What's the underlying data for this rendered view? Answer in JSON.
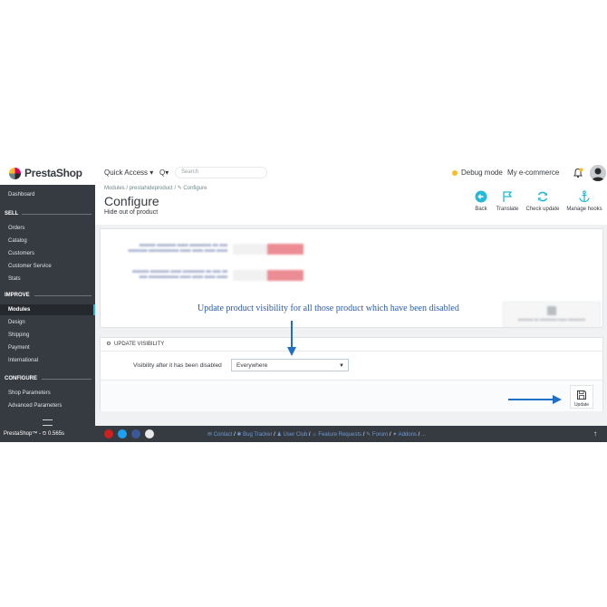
{
  "topbar": {
    "logo_text": "PrestaShop",
    "quick_access": "Quick Access ▾",
    "search_button": "Q▾",
    "search_placeholder": "Search",
    "debug_mode": "Debug mode",
    "shop_name": "My e-commerce"
  },
  "sidebar": {
    "dashboard": "Dashboard",
    "sections": [
      {
        "title": "SELL",
        "items": [
          "Orders",
          "Catalog",
          "Customers",
          "Customer Service",
          "Stats"
        ]
      },
      {
        "title": "IMPROVE",
        "items": [
          "Modules",
          "Design",
          "Shipping",
          "Payment",
          "International"
        ]
      },
      {
        "title": "CONFIGURE",
        "items": [
          "Shop Parameters",
          "Advanced Parameters"
        ]
      }
    ],
    "active_item": "Modules"
  },
  "header": {
    "breadcrumb": "Modules  /  prestahideproduct  /  ✎ Configure",
    "title": "Configure",
    "subtitle": "Hide out of product",
    "toolbar": {
      "back": "Back",
      "translate": "Translate",
      "check_update": "Check update",
      "manage_hooks": "Manage hooks"
    }
  },
  "annotation": {
    "text": "Update product visibility for all those product which have been disabled",
    "color": "#2a5ca8"
  },
  "update_visibility": {
    "heading": "UPDATE VISIBILITY",
    "label": "Visibility after it has been disabled",
    "selected": "Everywhere",
    "button": "Update"
  },
  "footer": {
    "version": "PrestaShop™ - ⏲ 0.565s",
    "links": [
      "Contact",
      "Bug Tracker",
      "User Club",
      "Feature Requests",
      "Forum",
      "Addons",
      "..."
    ]
  },
  "colors": {
    "sidebar": "#363a41",
    "accent": "#25b9d7",
    "brand_pink": "#df0067",
    "arrow_blue": "#1f6fc5"
  }
}
